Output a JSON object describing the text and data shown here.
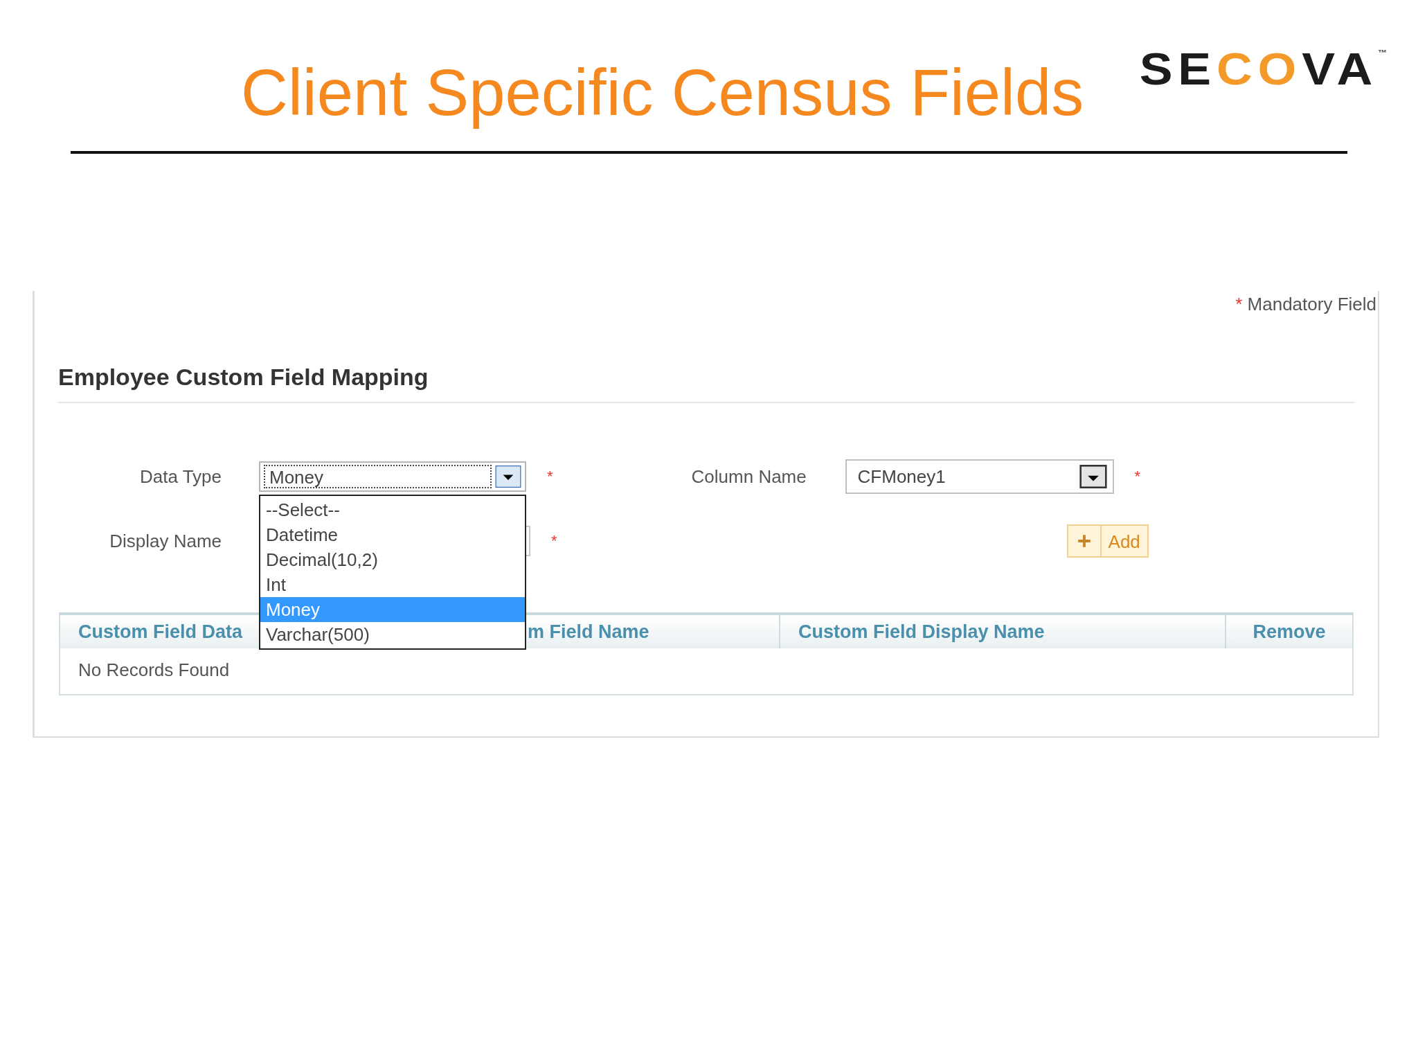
{
  "slide": {
    "title": "Client Specific Census Fields",
    "logo": {
      "parts": [
        {
          "text": "SE",
          "color": "#1c1c1c"
        },
        {
          "text": "CO",
          "color": "#f39a2b"
        },
        {
          "text": "VA",
          "color": "#1c1c1c"
        }
      ],
      "trademark": "™"
    }
  },
  "panel": {
    "mandatory_note": {
      "mark": "*",
      "text": "Mandatory Field"
    },
    "section_title": "Employee Custom Field Mapping",
    "data_type": {
      "label": "Data Type",
      "value": "Money",
      "required_mark": "*",
      "open": true,
      "options": [
        {
          "label": "--Select--",
          "selected": false
        },
        {
          "label": "Datetime",
          "selected": false
        },
        {
          "label": "Decimal(10,2)",
          "selected": false
        },
        {
          "label": "Int",
          "selected": false
        },
        {
          "label": "Money",
          "selected": true
        },
        {
          "label": "Varchar(500)",
          "selected": false
        }
      ]
    },
    "column_name": {
      "label": "Column Name",
      "value": "CFMoney1",
      "required_mark": "*"
    },
    "display_name": {
      "label": "Display Name",
      "required_mark": "*"
    },
    "add_button": {
      "label": "Add"
    },
    "table": {
      "columns": [
        "Custom Field Data",
        "m Field Name",
        "Custom Field Display Name",
        "Remove"
      ],
      "empty_message": "No Records Found"
    }
  }
}
